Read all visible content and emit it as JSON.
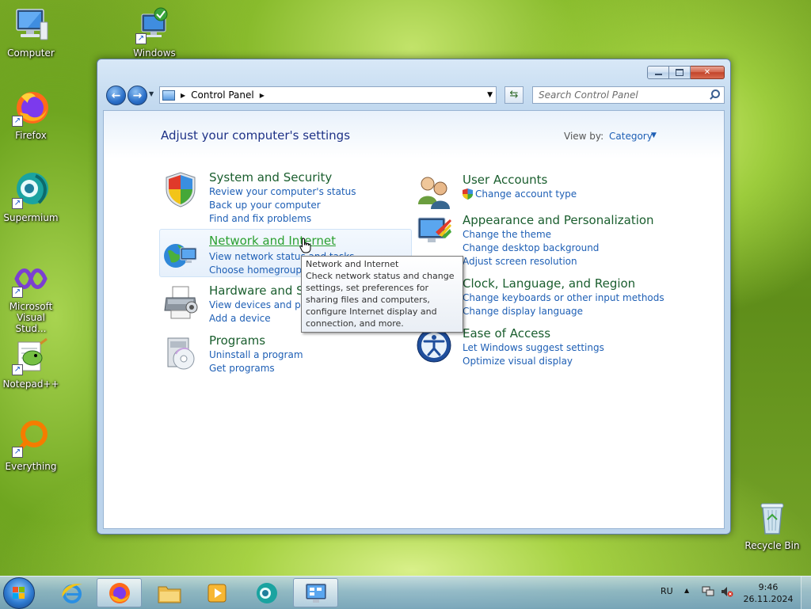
{
  "desktop": {
    "icons": [
      {
        "label": "Computer"
      },
      {
        "label": "Windows"
      },
      {
        "label": "Firefox"
      },
      {
        "label": "Supermium"
      },
      {
        "label": "Microsoft Visual Stud..."
      },
      {
        "label": "Notepad++"
      },
      {
        "label": "Everything"
      },
      {
        "label": "Recycle Bin"
      }
    ]
  },
  "window": {
    "caption_buttons": {
      "minimize": "minimize",
      "maximize": "maximize",
      "close": "close"
    },
    "address": {
      "segment": "Control Panel"
    },
    "search": {
      "placeholder": "Search Control Panel"
    },
    "title": "Adjust your computer's settings",
    "view_by": {
      "label": "View by:",
      "value": "Category"
    },
    "categories": [
      {
        "title": "System and Security",
        "links": [
          "Review your computer's status",
          "Back up your computer",
          "Find and fix problems"
        ]
      },
      {
        "title": "Network and Internet",
        "links": [
          "View network status and tasks",
          "Choose homegroup and sharing options"
        ]
      },
      {
        "title": "Hardware and Sound",
        "links": [
          "View devices and printers",
          "Add a device"
        ]
      },
      {
        "title": "Programs",
        "links": [
          "Uninstall a program",
          "Get programs"
        ]
      },
      {
        "title": "User Accounts",
        "links": [
          "Change account type"
        ]
      },
      {
        "title": "Appearance and Personalization",
        "links": [
          "Change the theme",
          "Change desktop background",
          "Adjust screen resolution"
        ]
      },
      {
        "title": "Clock, Language, and Region",
        "links": [
          "Change keyboards or other input methods",
          "Change display language"
        ]
      },
      {
        "title": "Ease of Access",
        "links": [
          "Let Windows suggest settings",
          "Optimize visual display"
        ]
      }
    ],
    "tooltip": {
      "title": "Network and Internet",
      "body": "Check network status and change settings, set preferences for sharing files and computers, configure Internet display and connection, and more."
    }
  },
  "taskbar": {
    "language": "RU",
    "time": "9:46",
    "date": "26.11.2024"
  },
  "colors": {
    "link": "#1e5fb5",
    "category_title": "#1a5e2e",
    "category_hover": "#2ba030",
    "heading": "#1e3287"
  }
}
